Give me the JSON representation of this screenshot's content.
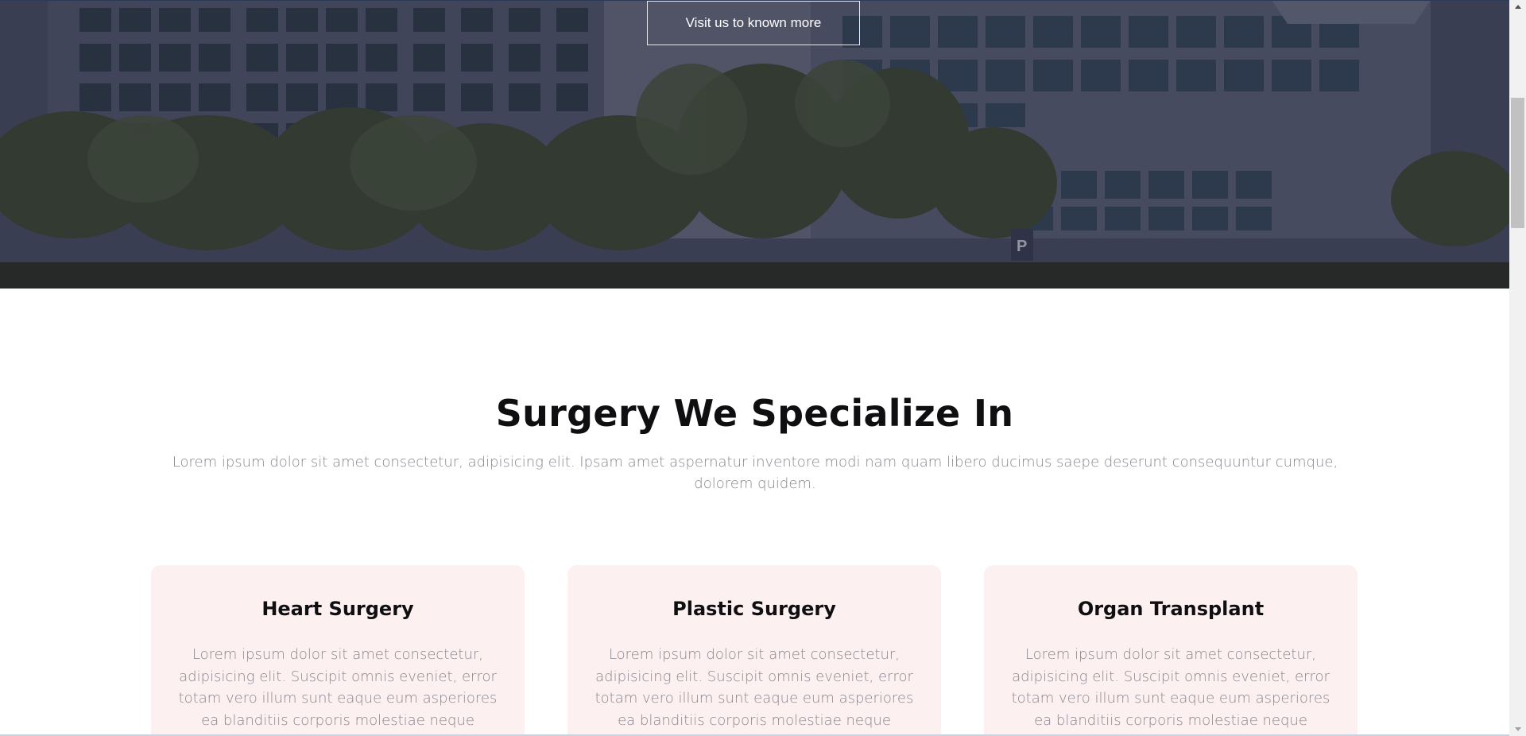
{
  "hero": {
    "cta_label": "Visit us to known more",
    "image_icon": "hospital-building-image"
  },
  "specialties": {
    "title": "Surgery We Specialize In",
    "description": "Lorem ipsum dolor sit amet consectetur, adipisicing elit. Ipsam amet aspernatur inventore modi nam quam libero ducimus saepe deserunt consequuntur cumque, dolorem quidem.",
    "cards": [
      {
        "title": "Heart Surgery",
        "text": "Lorem ipsum dolor sit amet consectetur, adipisicing elit. Suscipit omnis eveniet, error totam vero illum sunt eaque eum asperiores ea blanditiis corporis molestiae neque"
      },
      {
        "title": "Plastic Surgery",
        "text": "Lorem ipsum dolor sit amet consectetur, adipisicing elit. Suscipit omnis eveniet, error totam vero illum sunt eaque eum asperiores ea blanditiis corporis molestiae neque"
      },
      {
        "title": "Organ Transplant",
        "text": "Lorem ipsum dolor sit amet consectetur, adipisicing elit. Suscipit omnis eveniet, error totam vero illum sunt eaque eum asperiores ea blanditiis corporis molestiae neque"
      }
    ]
  },
  "colors": {
    "card_background": "#fdf0f0",
    "heading": "#0f0f12",
    "body_text": "#8a8690"
  }
}
